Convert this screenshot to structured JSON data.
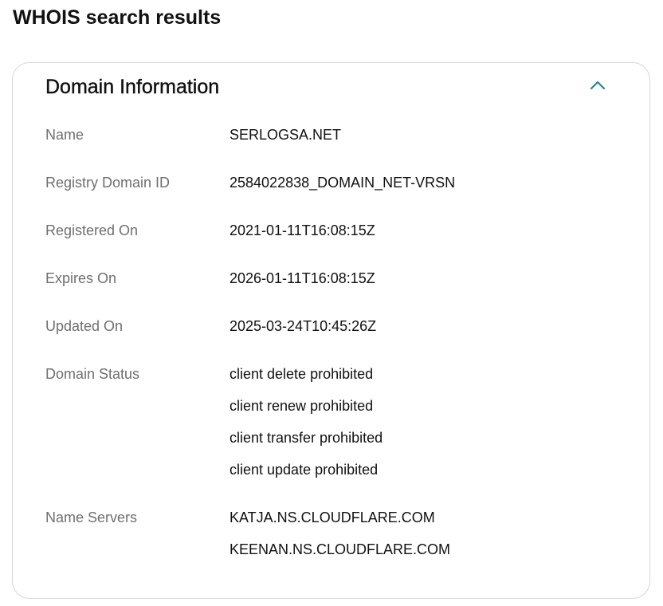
{
  "page": {
    "title": "WHOIS search results"
  },
  "card": {
    "title": "Domain Information",
    "toggle_icon": "chevron-up-icon",
    "accent_color": "#1f8a8a"
  },
  "rows": {
    "name": {
      "label": "Name",
      "value": "SERLOGSA.NET"
    },
    "registry_domain_id": {
      "label": "Registry Domain ID",
      "value": "2584022838_DOMAIN_NET-VRSN"
    },
    "registered_on": {
      "label": "Registered On",
      "value": "2021-01-11T16:08:15Z"
    },
    "expires_on": {
      "label": "Expires On",
      "value": "2026-01-11T16:08:15Z"
    },
    "updated_on": {
      "label": "Updated On",
      "value": "2025-03-24T10:45:26Z"
    },
    "domain_status": {
      "label": "Domain Status",
      "values": [
        "client delete prohibited",
        "client renew prohibited",
        "client transfer prohibited",
        "client update prohibited"
      ]
    },
    "name_servers": {
      "label": "Name Servers",
      "values": [
        "KATJA.NS.CLOUDFLARE.COM",
        "KEENAN.NS.CLOUDFLARE.COM"
      ]
    }
  }
}
